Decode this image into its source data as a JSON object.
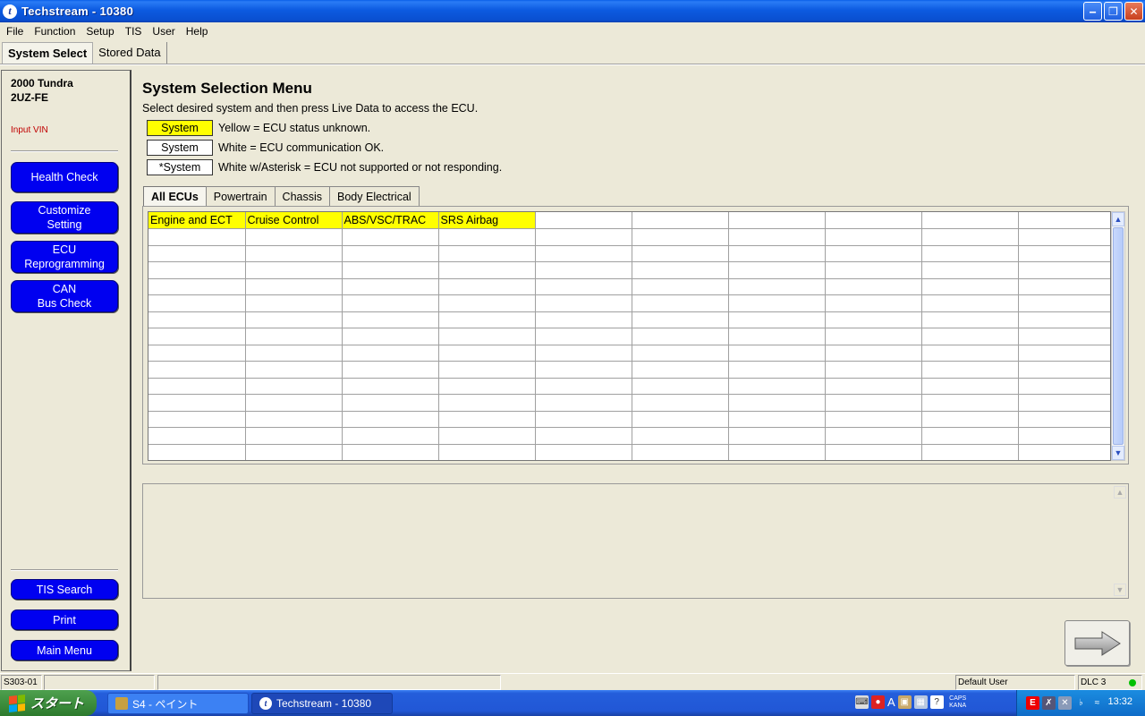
{
  "window": {
    "title": "Techstream - 10380"
  },
  "menu": [
    "File",
    "Function",
    "Setup",
    "TIS",
    "User",
    "Help"
  ],
  "top_tabs": [
    "System Select",
    "Stored Data"
  ],
  "vehicle": {
    "line1": "2000 Tundra",
    "line2": "2UZ-FE",
    "input_vin": "Input VIN"
  },
  "sidebar_buttons": {
    "health_check": "Health Check",
    "customize": "Customize\nSetting",
    "ecu_reprogramming": "ECU\nReprogramming",
    "can_bus_check": "CAN\nBus Check",
    "tis_search": "TIS Search",
    "print": "Print",
    "main_menu": "Main Menu"
  },
  "main": {
    "title": "System Selection Menu",
    "instruction": "Select desired system and then press Live Data to access the ECU.",
    "legend": [
      {
        "box": "System",
        "text": "Yellow = ECU status unknown.",
        "color": "#ffff00"
      },
      {
        "box": "System",
        "text": "White = ECU communication OK.",
        "color": "#ffffff"
      },
      {
        "box": "*System",
        "text": "White w/Asterisk = ECU not supported or not responding.",
        "color": "#ffffff"
      }
    ],
    "ecu_tabs": [
      "All ECUs",
      "Powertrain",
      "Chassis",
      "Body Electrical"
    ],
    "systems": [
      "Engine and ECT",
      "Cruise Control",
      "ABS/VSC/TRAC",
      "SRS Airbag"
    ]
  },
  "status_bar": {
    "screen_id": "S303-01",
    "user": "Default User",
    "connection": "DLC 3"
  },
  "taskbar": {
    "start": "スタート",
    "tasks": [
      "S4 - ペイント",
      "Techstream - 10380"
    ],
    "clock": "13:32"
  },
  "colors": {
    "accent_button": "#0000f0",
    "unknown_status": "#ffff00",
    "connected": "#00c000"
  }
}
